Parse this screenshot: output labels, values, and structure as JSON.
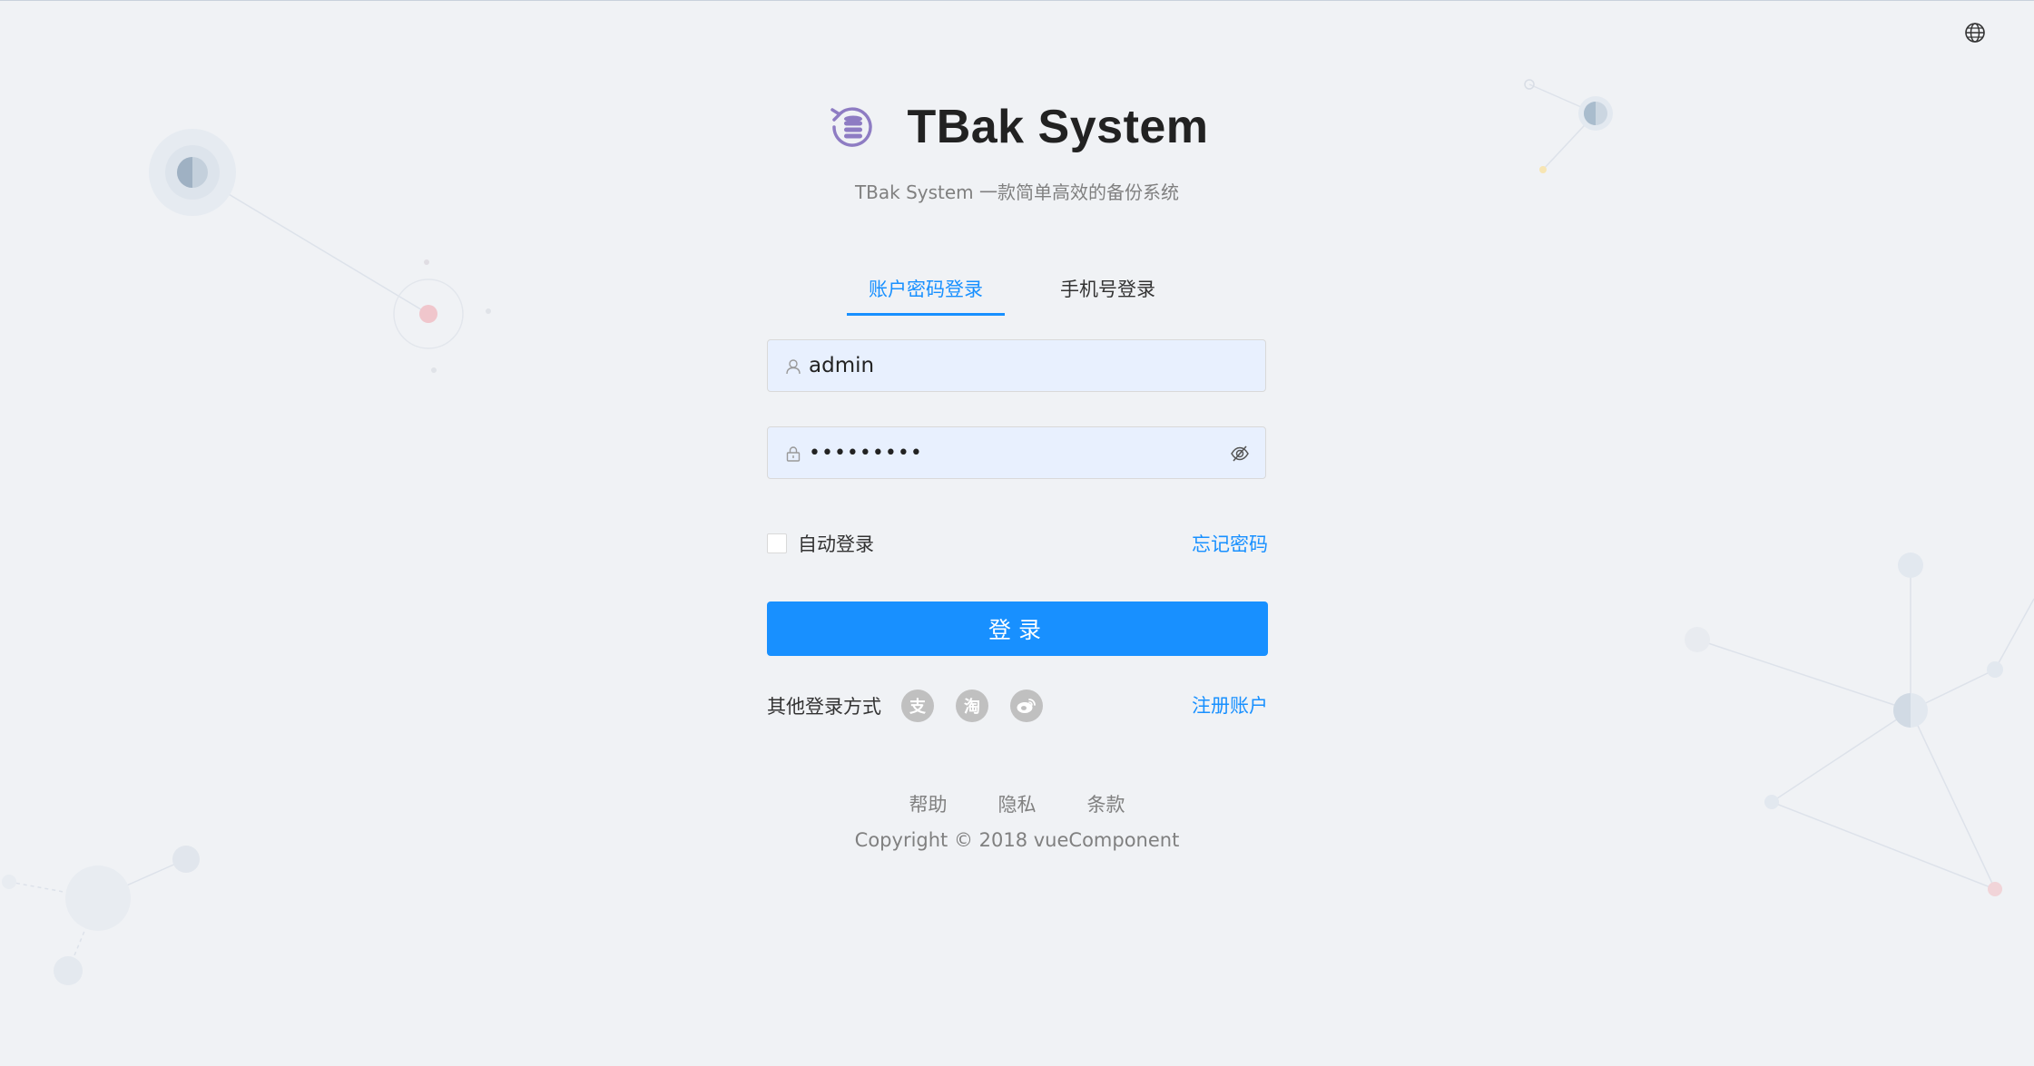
{
  "app": {
    "title": "TBak System",
    "subtitle": "TBak System 一款简单高效的备份系统"
  },
  "topbar": {
    "language_icon": "globe-icon"
  },
  "tabs": [
    {
      "label": "账户密码登录",
      "active": true
    },
    {
      "label": "手机号登录",
      "active": false
    }
  ],
  "form": {
    "username": {
      "value": "admin",
      "icon": "user-icon"
    },
    "password": {
      "value": "•••••••••",
      "icon": "lock-icon",
      "toggle_icon": "eye-invisible-icon"
    },
    "remember_label": "自动登录",
    "remember_checked": false,
    "forgot_label": "忘记密码",
    "submit_label": "登录"
  },
  "other_login": {
    "label": "其他登录方式",
    "providers": [
      {
        "name": "alipay-icon",
        "glyph": "支"
      },
      {
        "name": "taobao-icon",
        "glyph": "淘"
      },
      {
        "name": "weibo-icon",
        "glyph": "微"
      }
    ],
    "register_label": "注册账户"
  },
  "footer": {
    "links": [
      "帮助",
      "隐私",
      "条款"
    ],
    "copyright": "Copyright © 2018 vueComponent"
  },
  "colors": {
    "primary": "#1890ff",
    "background": "#f0f2f5",
    "input_bg": "#e8f0fe",
    "logo": "#8e7cc3"
  }
}
